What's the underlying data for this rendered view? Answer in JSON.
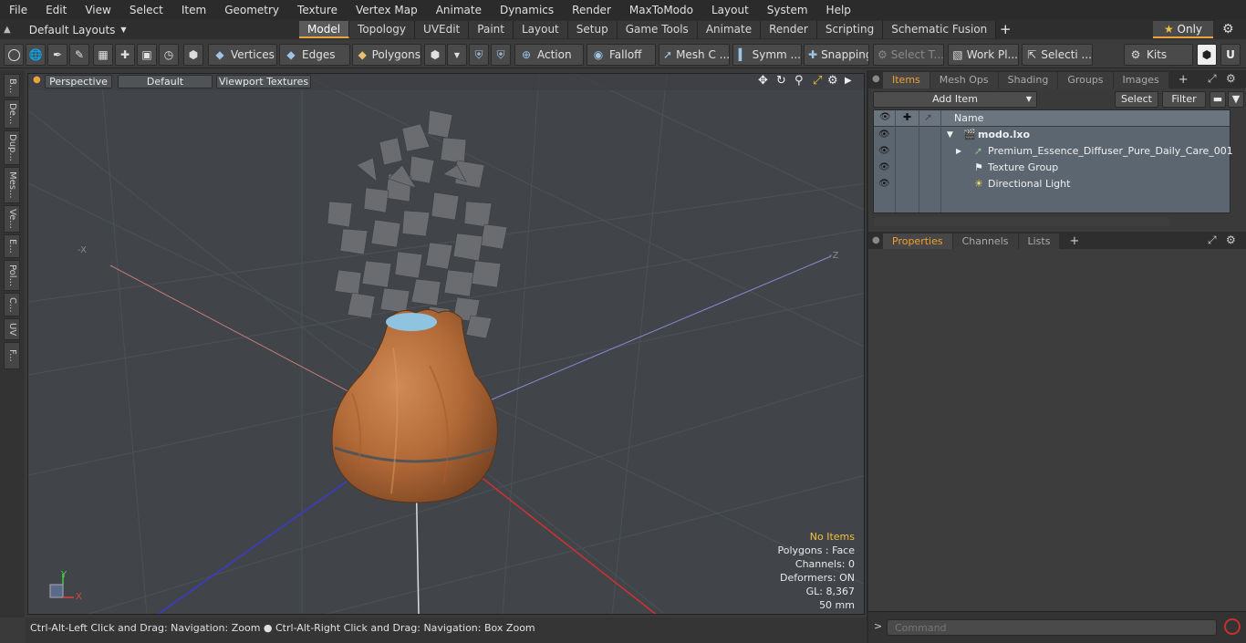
{
  "menu": [
    "File",
    "Edit",
    "View",
    "Select",
    "Item",
    "Geometry",
    "Texture",
    "Vertex Map",
    "Animate",
    "Dynamics",
    "Render",
    "MaxToModo",
    "Layout",
    "System",
    "Help"
  ],
  "layouts": {
    "label": "Default Layouts"
  },
  "tabs": [
    "Model",
    "Topology",
    "UVEdit",
    "Paint",
    "Layout",
    "Setup",
    "Game Tools",
    "Animate",
    "Render",
    "Scripting",
    "Schematic Fusion"
  ],
  "only_label": "Only",
  "toolbar": {
    "vertices": "Vertices",
    "edges": "Edges",
    "polygons": "Polygons",
    "action": "Action",
    "falloff": "Falloff",
    "mesh": "Mesh C ...",
    "symm": "Symm ...",
    "snapping": "Snapping",
    "select_t": "Select T...",
    "work_pl": "Work Pl...",
    "selecti": "Selecti ...",
    "kits": "Kits"
  },
  "left_tabs": [
    "B...",
    "De...",
    "Dup...",
    "Mes...",
    "Ve...",
    "E...",
    "Pol...",
    "C...",
    "UV",
    "F..."
  ],
  "viewport": {
    "perspective": "Perspective",
    "default": "Default",
    "textures": "Viewport Textures",
    "axis_x": "-X",
    "axis_z": "-Z",
    "info": {
      "no_items": "No Items",
      "polygons": "Polygons : Face",
      "channels": "Channels: 0",
      "deformers": "Deformers: ON",
      "gl": "GL: 8,367",
      "mm": "50 mm"
    }
  },
  "status": "Ctrl-Alt-Left Click and Drag: Navigation: Zoom ● Ctrl-Alt-Right Click and Drag: Navigation: Box Zoom",
  "items_panel": {
    "tabs": [
      "Items",
      "Mesh Ops",
      "Shading",
      "Groups",
      "Images"
    ],
    "add_item": "Add Item",
    "select": "Select",
    "filter": "Filter",
    "name_col": "Name",
    "rows": [
      "modo.lxo",
      "Premium_Essence_Diffuser_Pure_Daily_Care_001",
      "Texture Group",
      "Directional Light"
    ]
  },
  "props_panel": {
    "tabs": [
      "Properties",
      "Channels",
      "Lists"
    ]
  },
  "command": {
    "placeholder": "Command"
  }
}
